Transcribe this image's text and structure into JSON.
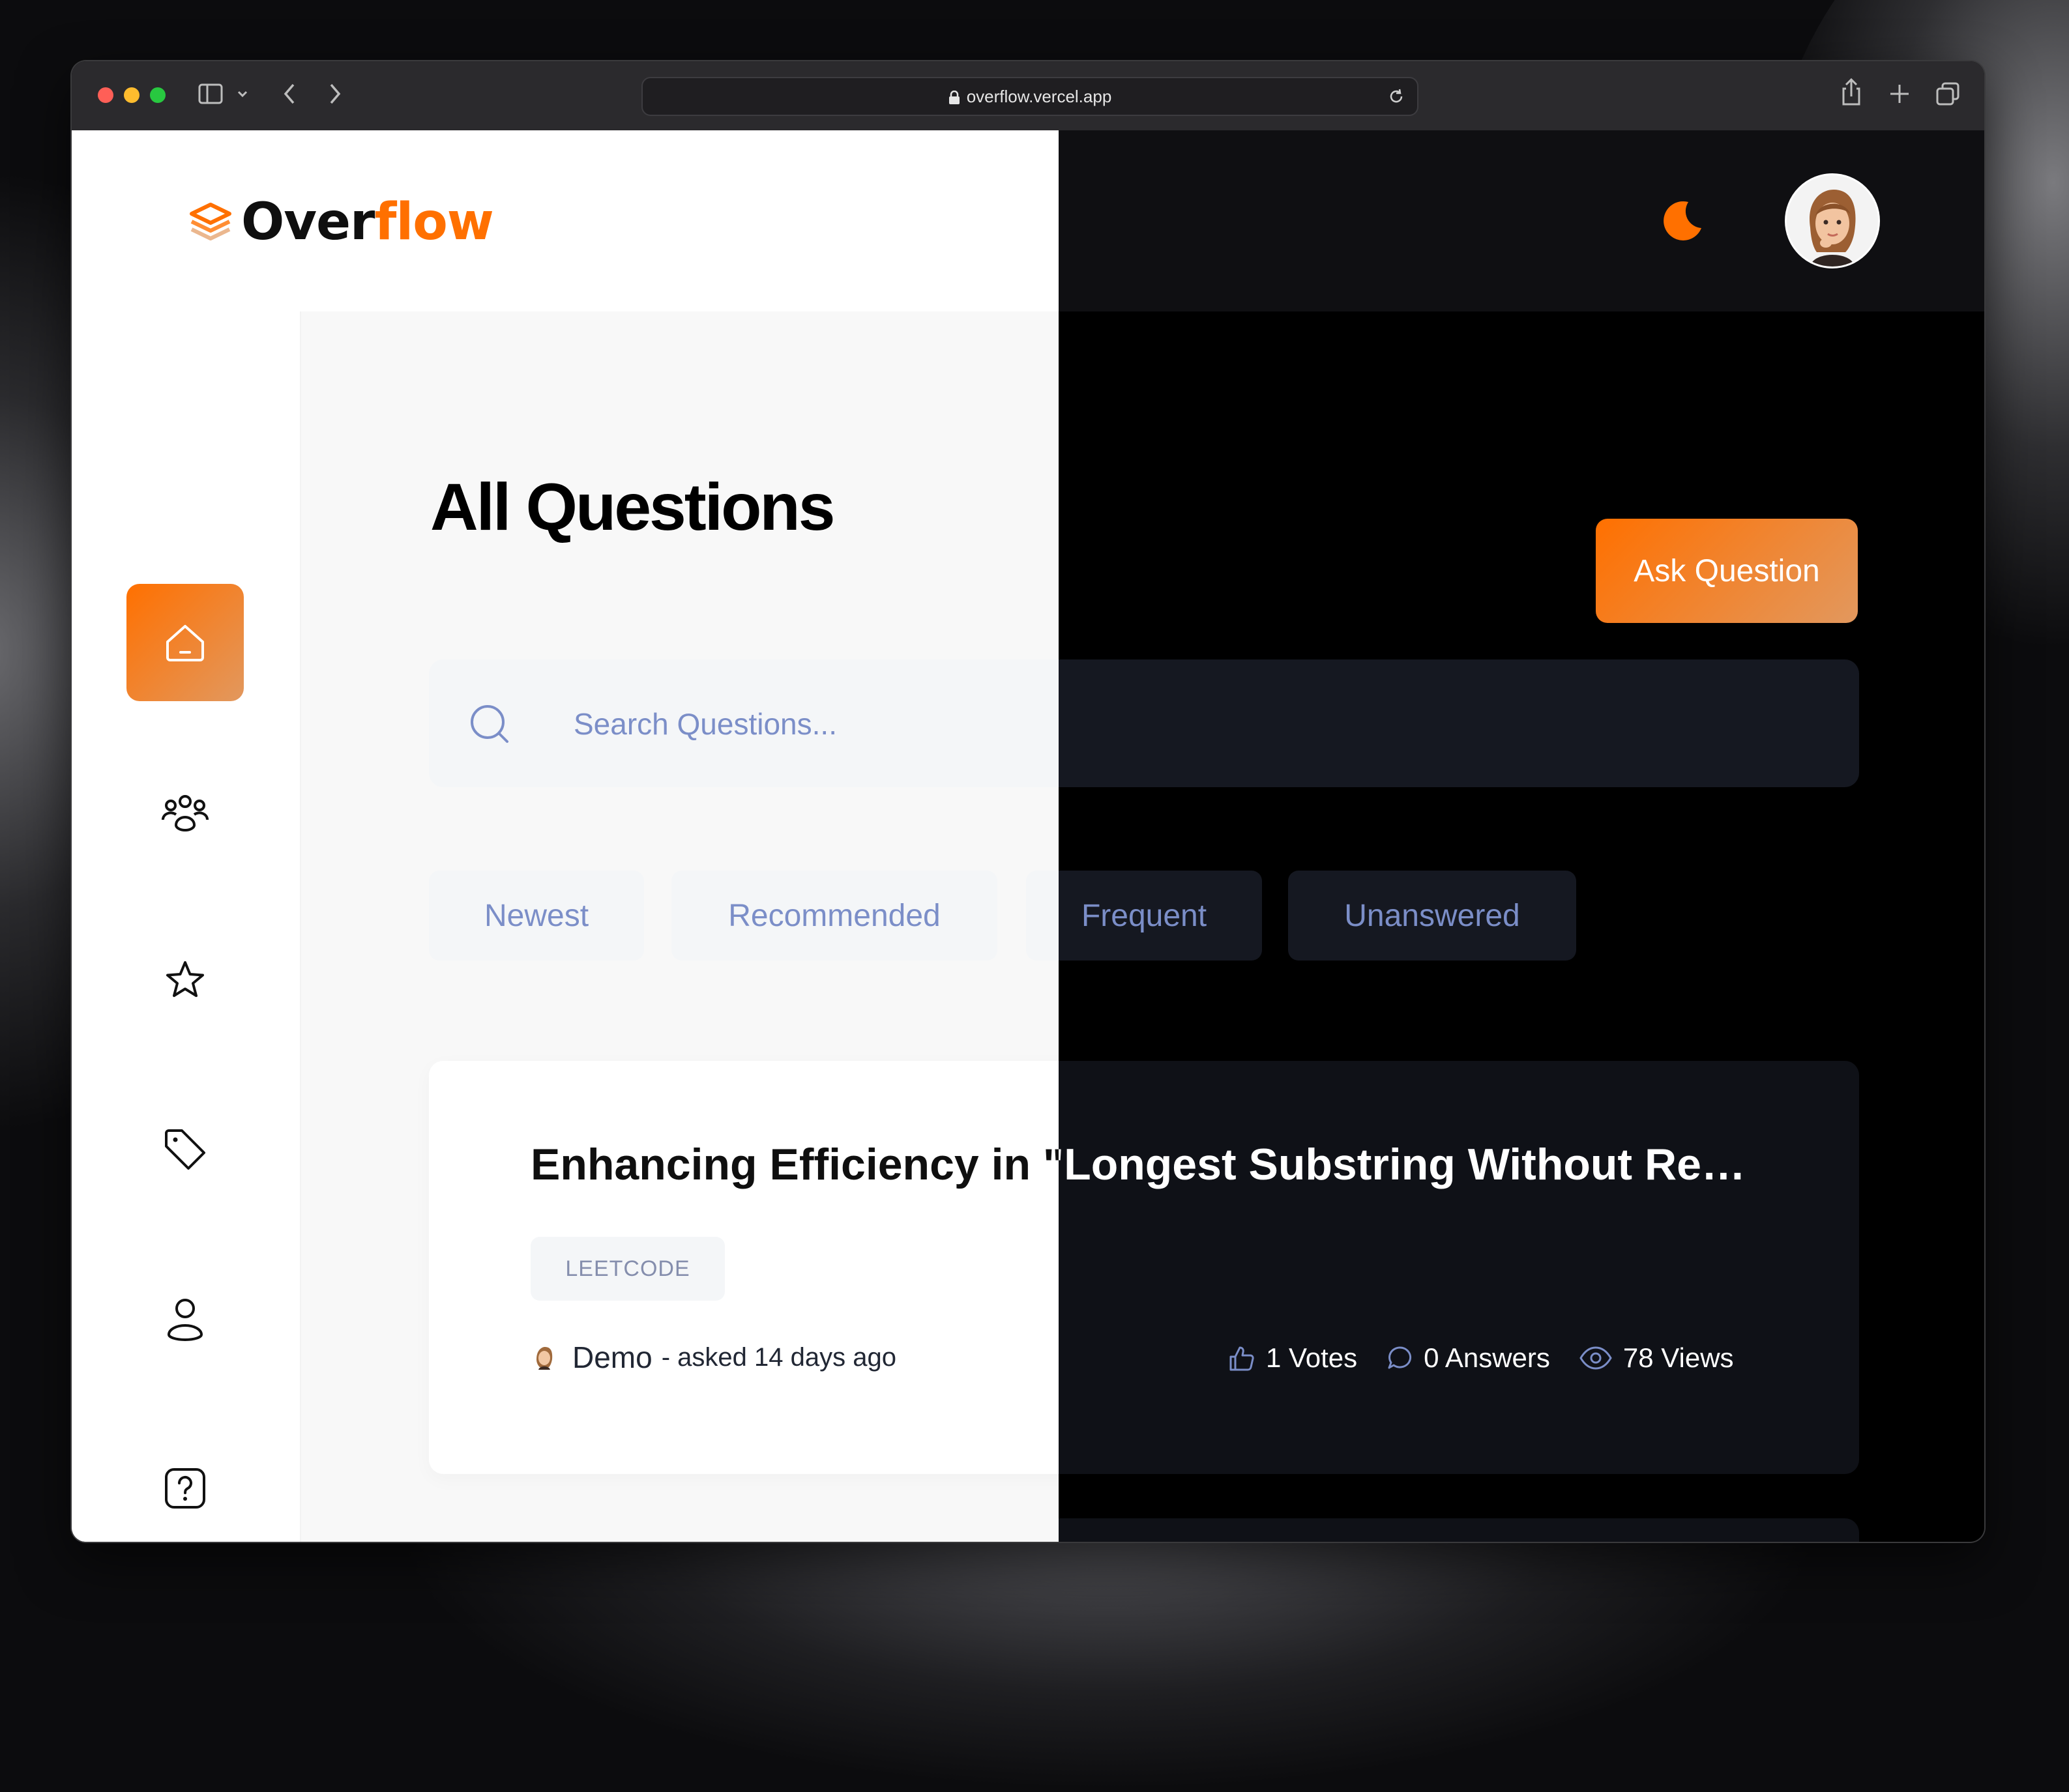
{
  "browser": {
    "url": "overflow.vercel.app"
  },
  "app": {
    "logo_part1": "Over",
    "logo_part2": "flow",
    "brand_color": "#ff7000"
  },
  "sidebar": {
    "items": [
      {
        "name": "home",
        "icon": "home-icon",
        "active": true
      },
      {
        "name": "community",
        "icon": "users-icon",
        "active": false
      },
      {
        "name": "collections",
        "icon": "star-icon",
        "active": false
      },
      {
        "name": "tags",
        "icon": "tag-icon",
        "active": false
      },
      {
        "name": "profile",
        "icon": "user-icon",
        "active": false
      },
      {
        "name": "ask",
        "icon": "question-icon",
        "active": false
      }
    ]
  },
  "main": {
    "title": "All Questions",
    "ask_button": "Ask Question",
    "search_placeholder": "Search Questions...",
    "filters": [
      "Newest",
      "Recommended",
      "Frequent",
      "Unanswered"
    ]
  },
  "question": {
    "title": "Enhancing Efficiency in \"Longest Substring Without Repeating Characters\"",
    "tag": "LEETCODE",
    "author": "Demo",
    "asked": "- asked 14 days ago",
    "votes": "1 Votes",
    "answers": "0 Answers",
    "views": "78 Views"
  }
}
